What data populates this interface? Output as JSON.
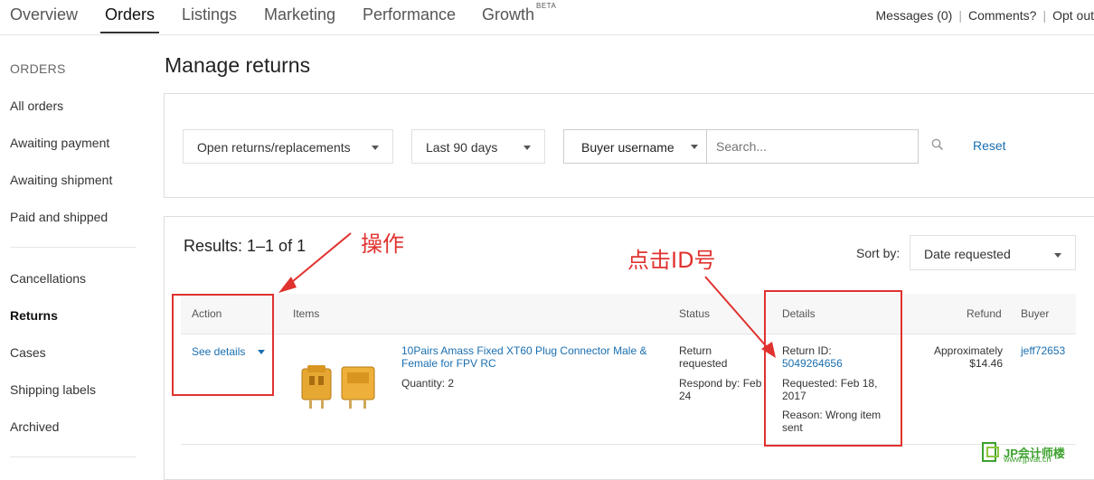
{
  "top_nav": {
    "tabs": [
      {
        "label": "Overview"
      },
      {
        "label": "Orders"
      },
      {
        "label": "Listings"
      },
      {
        "label": "Marketing"
      },
      {
        "label": "Performance"
      },
      {
        "label": "Growth"
      }
    ],
    "active_tab": "Orders",
    "growth_badge": "BETA",
    "messages": "Messages (0)",
    "comments": "Comments?",
    "opt_out": "Opt out"
  },
  "sidebar": {
    "heading": "ORDERS",
    "items": [
      {
        "label": "All orders"
      },
      {
        "label": "Awaiting payment"
      },
      {
        "label": "Awaiting shipment"
      },
      {
        "label": "Paid and shipped"
      },
      {
        "label": "Cancellations"
      },
      {
        "label": "Returns"
      },
      {
        "label": "Cases"
      },
      {
        "label": "Shipping labels"
      },
      {
        "label": "Archived"
      }
    ],
    "active_item": "Returns"
  },
  "page_title": "Manage returns",
  "filters": {
    "status_select": "Open returns/replacements",
    "date_select": "Last 90 days",
    "search_field_select": "Buyer username",
    "search_placeholder": "Search...",
    "reset_label": "Reset"
  },
  "results": {
    "summary": "Results: 1–1 of 1",
    "sort_label": "Sort by:",
    "sort_value": "Date requested",
    "columns": {
      "action": "Action",
      "items": "Items",
      "status": "Status",
      "details": "Details",
      "refund": "Refund",
      "buyer": "Buyer"
    },
    "rows": [
      {
        "action": "See details",
        "item_title": "10Pairs Amass Fixed XT60 Plug Connector Male & Female for FPV RC",
        "quantity": "Quantity: 2",
        "status": "Return requested",
        "respond_by": "Respond by: Feb 24",
        "return_id_label": "Return ID:",
        "return_id": "5049264656",
        "requested": "Requested: Feb 18, 2017",
        "reason": "Reason: Wrong item sent",
        "refund_line1": "Approximately",
        "refund_line2": "$14.46",
        "buyer": "jeff72653"
      }
    ]
  },
  "annotations": {
    "action_note": "操作",
    "id_note": "点击ID号",
    "color": "#e0322f"
  },
  "watermark": {
    "name": "JP会计师楼",
    "url": "www.jpvat.cn",
    "color": "#3da22e"
  }
}
